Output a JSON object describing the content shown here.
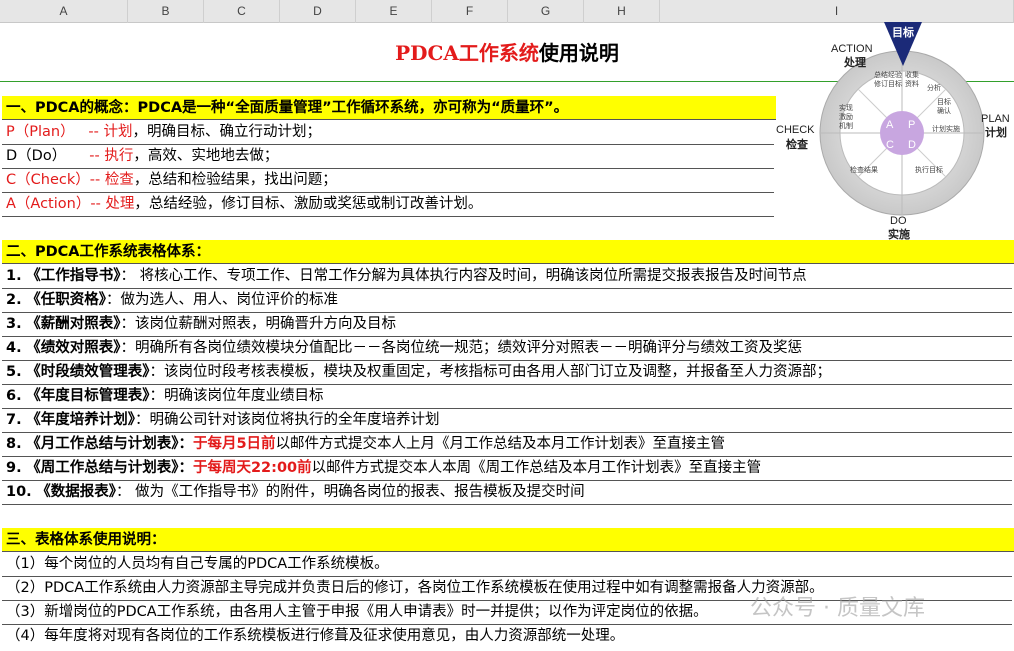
{
  "columns": [
    "A",
    "B",
    "C",
    "D",
    "E",
    "F",
    "G",
    "H",
    "I"
  ],
  "title": {
    "red": "PDCA工作系统",
    "black": "使用说明"
  },
  "section1": {
    "header": "一、PDCA的概念：PDCA是一种“全面质量管理”工作循环系统，亦可称为“质量环”。",
    "rows": [
      {
        "key": "P（Plan）",
        "sep": "   -- ",
        "term": "计划",
        "rest": "，明确目标、确立行动计划；"
      },
      {
        "key": "D（Do）",
        "sep": "     -- ",
        "term": "执行",
        "rest": "，高效、实地地去做；"
      },
      {
        "key": "C（Check）",
        "sep": "-- ",
        "term": "检查",
        "rest": "，总结和检验结果，找出问题；"
      },
      {
        "key": "A（Action）",
        "sep": "-- ",
        "term": "处理",
        "rest": "，总结经验，修订目标、激励或奖惩或制订改善计划。"
      }
    ]
  },
  "diagram": {
    "top": "目标",
    "action": "ACTION",
    "action_cn": "处理",
    "plan": "PLAN",
    "plan_cn": "计划",
    "check": "CHECK",
    "check_cn": "检查",
    "do": "DO",
    "do_cn": "实施",
    "inner": [
      "总结经验",
      "修订目标",
      "收集",
      "资料",
      "分析",
      "目标",
      "确认",
      "计划实施",
      "执行目标",
      "检查结果",
      "实现",
      "激励",
      "机制"
    ],
    "letters": [
      "A",
      "P",
      "C",
      "D"
    ]
  },
  "section2": {
    "header": "二、PDCA工作系统表格体系：",
    "items": [
      {
        "num": "1.",
        "name": "《工作指导书》",
        "desc": "：  将核心工作、专项工作、日常工作分解为具体执行内容及时间，明确该岗位所需提交报表报告及时间节点"
      },
      {
        "num": "2.",
        "name": "《任职资格》",
        "desc": "：做为选人、用人、岗位评价的标准"
      },
      {
        "num": "3.",
        "name": "《薪酬对照表》",
        "desc": "：该岗位薪酬对照表，明确晋升方向及目标"
      },
      {
        "num": "4.",
        "name": "《绩效对照表》",
        "desc": "：明确所有各岗位绩效模块分值配比－－各岗位统一规范；绩效评分对照表－－明确评分与绩效工资及奖惩"
      },
      {
        "num": "5.",
        "name": "《时段绩效管理表》",
        "desc": "：该岗位时段考核表模板，模块及权重固定，考核指标可由各用人部门订立及调整，并报备至人力资源部；"
      },
      {
        "num": "6.",
        "name": "《年度目标管理表》",
        "desc": "：明确该岗位年度业绩目标"
      },
      {
        "num": "7.",
        "name": "《年度培养计划》",
        "desc": "：明确公司针对该岗位将执行的全年度培养计划"
      },
      {
        "num": "8.",
        "name": "《月工作总结与计划表》",
        "desc_pre": "：",
        "red": "于每月5日前",
        "desc": "以邮件方式提交本人上月《月工作总结及本月工作计划表》至直接主管"
      },
      {
        "num": "9.",
        "name": "《周工作总结与计划表》",
        "desc_pre": "：",
        "red": "于每周天22:00前",
        "desc": "以邮件方式提交本人本周《周工作总结及本月工作计划表》至直接主管"
      },
      {
        "num": "10.",
        "name": " 《数据报表》",
        "desc": "：  做为《工作指导书》的附件，明确各岗位的报表、报告模板及提交时间"
      }
    ]
  },
  "section3": {
    "header": "三、表格体系使用说明：",
    "items": [
      "（1）每个岗位的人员均有自己专属的PDCA工作系统模板。",
      "（2）PDCA工作系统由人力资源部主导完成并负责日后的修订，各岗位工作系统模板在使用过程中如有调整需报备人力资源部。",
      "（3）新增岗位的PDCA工作系统，由各用人主管于申报《用人申请表》时一并提供；以作为评定岗位的依据。",
      "（4）每年度将对现有各岗位的工作系统模板进行修葺及征求使用意见，由人力资源部统一处理。"
    ]
  },
  "watermark": "公众号 · 质量文库"
}
